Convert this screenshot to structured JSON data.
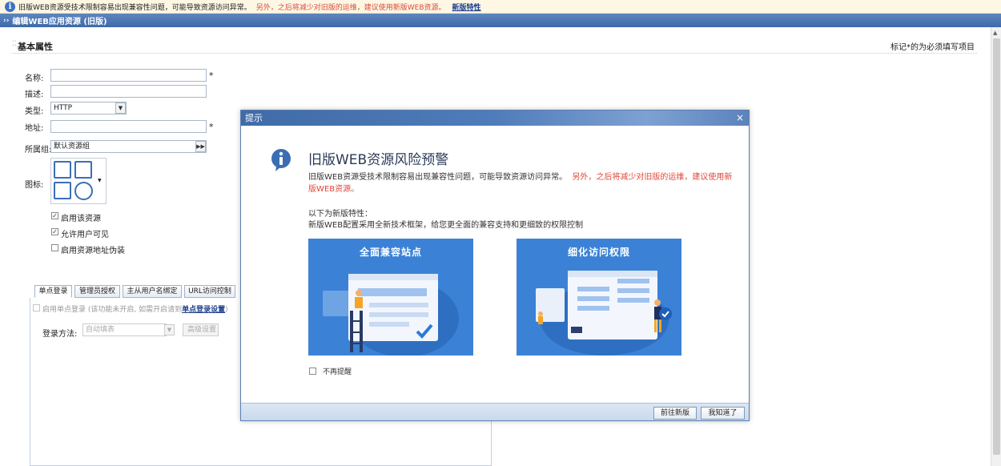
{
  "notice": {
    "text": "旧版WEB资源受技术限制容易出现兼容性问题，可能导致资源访问异常。",
    "warning": "另外，之后将减少对旧版的运维，建议使用新版WEB资源。",
    "link": "新版特性"
  },
  "titlebar": {
    "title": "编辑WEB应用资源 (旧版)"
  },
  "section": {
    "title": "基本属性",
    "required_note": "标记*的为必须填写项目"
  },
  "form": {
    "name_label": "名称:",
    "name_value": "",
    "desc_label": "描述:",
    "desc_value": "",
    "type_label": "类型:",
    "type_value": "HTTP",
    "addr_label": "地址:",
    "addr_value": "",
    "group_label": "所属组:",
    "group_value": "默认资源组",
    "icon_label": "图标:",
    "required_mark": "*",
    "checkbox_enable": "启用该资源",
    "checkbox_visible": "允许用户可见",
    "checkbox_disguise": "启用资源地址伪装",
    "enable_checked": true,
    "visible_checked": true,
    "disguise_checked": false
  },
  "tabs": {
    "items": [
      "单点登录",
      "管理员授权",
      "主从用户名绑定",
      "URL访问控制"
    ],
    "sso_note": "启用单点登录 (该功能未开启, 如需开启请到",
    "sso_link": "单点登录设置",
    "sso_note_end": ")",
    "login_method_label": "登录方法:",
    "login_method_value": "自动填表",
    "advanced_button": "高级设置"
  },
  "dialog": {
    "header": "提示",
    "close": "×",
    "title": "旧版WEB资源风险预警",
    "text": "旧版WEB资源受技术限制容易出现兼容性问题，可能导致资源访问异常。",
    "text_red": "另外，之后将减少对旧版的运维，建议使用新版WEB资源。",
    "features_title": "以下为新版特性：",
    "features_desc": "新版WEB配置采用全新技术框架，给您更全面的兼容支持和更细致的权限控制",
    "card1_title": "全面兼容站点",
    "card2_title": "细化访问权限",
    "dont_remind": "不再提醒",
    "btn_goto_new": "前往新版",
    "btn_got_it": "我知道了"
  },
  "colors": {
    "accent": "#3b82d6",
    "header": "#4a75b2",
    "warning": "#d94a3b"
  }
}
